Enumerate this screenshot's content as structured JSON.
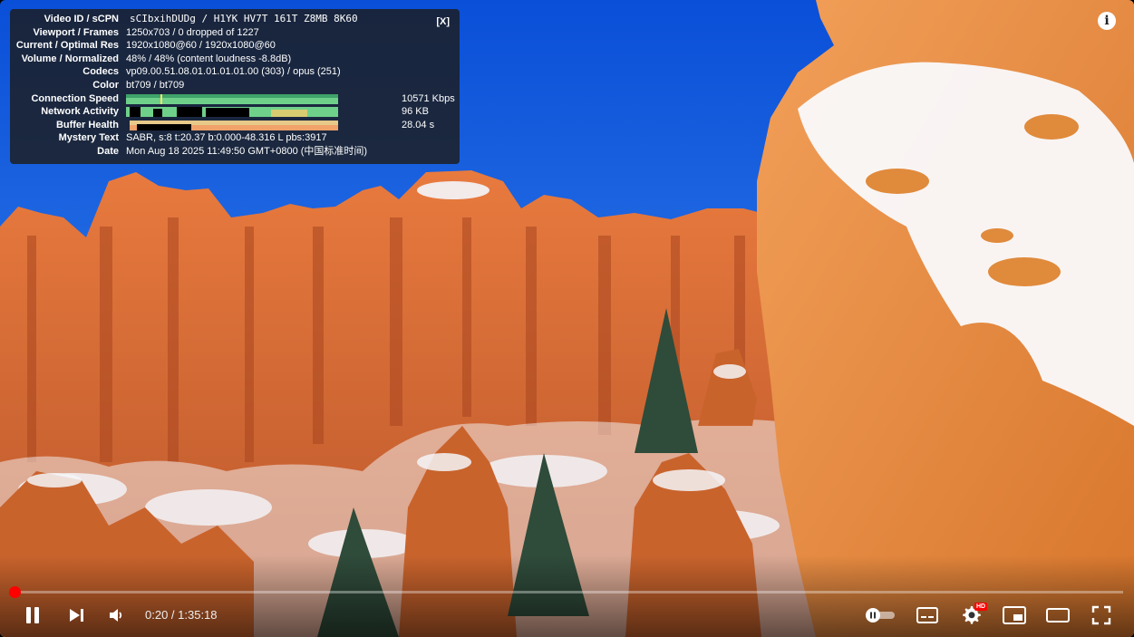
{
  "stats": {
    "close_label": "[X]",
    "rows": [
      {
        "label": "Video ID / sCPN",
        "value": "sCIbxihDUDg / H1YK HV7T 161T Z8MB 8K60"
      },
      {
        "label": "Viewport / Frames",
        "value": "1250x703 / 0 dropped of 1227"
      },
      {
        "label": "Current / Optimal Res",
        "value": "1920x1080@60 / 1920x1080@60"
      },
      {
        "label": "Volume / Normalized",
        "value": "48% / 48% (content loudness -8.8dB)"
      },
      {
        "label": "Codecs",
        "value": "vp09.00.51.08.01.01.01.01.00 (303) / opus (251)"
      },
      {
        "label": "Color",
        "value": "bt709 / bt709"
      },
      {
        "label": "Connection Speed",
        "value": "10571 Kbps"
      },
      {
        "label": "Network Activity",
        "value": "96 KB"
      },
      {
        "label": "Buffer Health",
        "value": "28.04 s"
      },
      {
        "label": "Mystery Text",
        "value": "SABR, s:8 t:20.37 b:0.000-48.316 L pbs:3917"
      },
      {
        "label": "Date",
        "value": "Mon Aug 18 2025 11:49:50 GMT+0800 (中国标准时间)"
      }
    ]
  },
  "info_icon": "i",
  "controls": {
    "time_display": "0:20 / 1:35:18",
    "progress_fraction": 0.0035,
    "quality_badge": "HD",
    "icons": [
      "pause-icon",
      "next-icon",
      "volume-icon",
      "autoplay-toggle-icon",
      "subtitles-icon",
      "settings-icon",
      "miniplayer-icon",
      "theater-icon",
      "fullscreen-icon"
    ]
  },
  "colors": {
    "accent": "#ff0000",
    "stats_bg": "#1c1c1c"
  }
}
